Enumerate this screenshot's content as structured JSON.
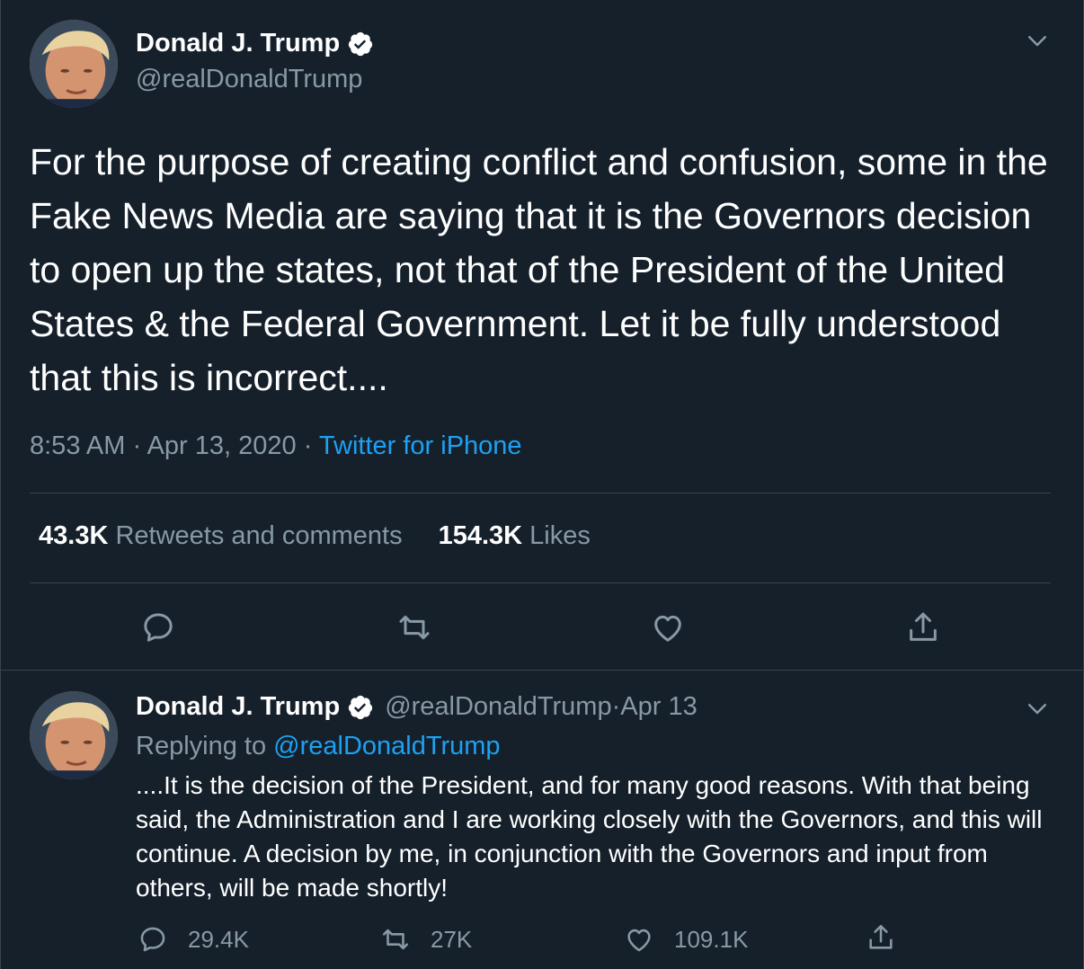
{
  "main_tweet": {
    "author_name": "Donald J. Trump",
    "author_handle": "@realDonaldTrump",
    "text": "For the purpose of creating conflict and confusion, some in the Fake News Media are saying that it is the Governors decision to open up the states, not that of the President of the United States & the Federal Government. Let it be fully understood that this is incorrect....",
    "time": "8:53 AM",
    "sep1": " · ",
    "date": "Apr 13, 2020",
    "sep2": " · ",
    "source": "Twitter for iPhone",
    "retweets_count": "43.3K",
    "retweets_label": " Retweets and comments",
    "likes_count": "154.3K",
    "likes_label": " Likes",
    "icons": [
      "reply-icon",
      "retweet-icon",
      "like-icon",
      "share-icon"
    ]
  },
  "reply_tweet": {
    "author_name": "Donald J. Trump",
    "author_handle": "@realDonaldTrump",
    "date_sep": " · ",
    "date": "Apr 13",
    "replying_to_label": "Replying to ",
    "replying_to_handle": "@realDonaldTrump",
    "text": "....It is the decision of the President, and for many good reasons. With that being said, the Administration and I are working closely with the Governors, and this will continue. A decision by me, in conjunction with the Governors and input from others, will be made shortly!",
    "replies": "29.4K",
    "retweets": "27K",
    "likes": "109.1K"
  },
  "colors": {
    "background": "#15202b",
    "border": "#38444d",
    "secondary_text": "#8899a6",
    "accent": "#1da1f2",
    "primary_text": "#ffffff"
  }
}
